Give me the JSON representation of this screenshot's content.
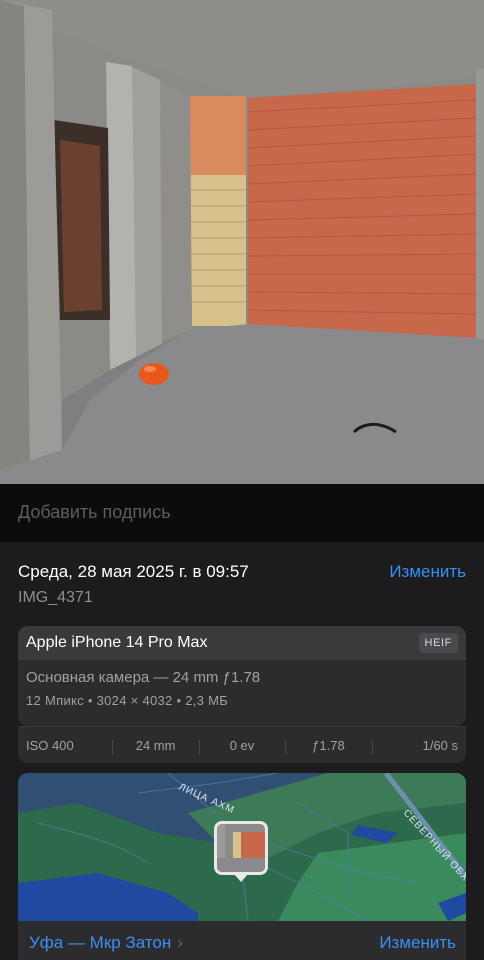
{
  "caption": {
    "placeholder": "Добавить подпись"
  },
  "info": {
    "date": "Среда, 28 мая 2025 г. в 09:57",
    "edit_label": "Изменить",
    "filename": "IMG_4371"
  },
  "camera": {
    "device": "Apple iPhone 14 Pro Max",
    "format": "HEIF",
    "lens": "Основная камера — 24 mm ƒ1.78",
    "specs": "12 Мпикс • 3024 × 4032 • 2,3 МБ",
    "exif": [
      "ISO 400",
      "24 mm",
      "0 ev",
      "ƒ1.78",
      "1/60 s"
    ]
  },
  "map": {
    "street_label": "ЛИЦА АХМ",
    "road_label": "СЕВЕРНЫЙ ОБХОД"
  },
  "location": {
    "name": "Уфа — Мкр Затон",
    "chevron": "›",
    "edit_label": "Изменить"
  },
  "colors": {
    "accent": "#3a8ff5",
    "panel": "#1c1c1e",
    "card": "#2c2c2e"
  }
}
